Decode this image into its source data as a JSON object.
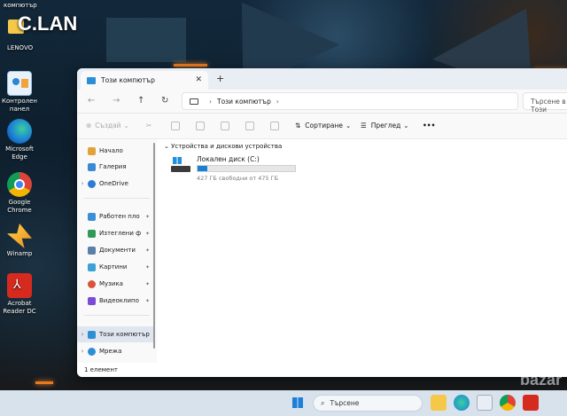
{
  "desktop": {
    "top_label": "компютър",
    "shortcut_lan": "C.LAN",
    "lenovo_label": "LENOVO",
    "icons": [
      {
        "label": "Контролен панел",
        "icon": "control-panel-icon"
      },
      {
        "label": "Microsoft Edge",
        "icon": "edge-icon"
      },
      {
        "label": "Google Chrome",
        "icon": "chrome-icon"
      },
      {
        "label": "Winamp",
        "icon": "winamp-icon"
      },
      {
        "label": "Acrobat Reader DC",
        "icon": "acrobat-icon"
      }
    ],
    "watermark": "bazar"
  },
  "explorer": {
    "tab_title": "Този компютър",
    "new_tab": "+",
    "close": "✕",
    "nav": {
      "back": "←",
      "forward": "→",
      "up": "↑",
      "refresh": "↻"
    },
    "address": {
      "path": "Този компютър",
      "sep": "›",
      "chevron": "›"
    },
    "search_placeholder": "Търсене в Този",
    "toolbar": {
      "new_label": "Създай",
      "sort_label": "Сортиране",
      "view_label": "Преглед",
      "more": "•••"
    },
    "sidebar": {
      "items": [
        {
          "label": "Начало",
          "icon": "home-icon",
          "color": "#e0a33a"
        },
        {
          "label": "Галерия",
          "icon": "gallery-icon",
          "color": "#3a8ad6"
        },
        {
          "label": "OneDrive",
          "icon": "cloud-icon",
          "color": "#2b7cd3"
        },
        {
          "label": "Работен пло",
          "icon": "desktop-icon",
          "color": "#3b8fd9"
        },
        {
          "label": "Изтеглени ф",
          "icon": "download-icon",
          "color": "#2f9a55"
        },
        {
          "label": "Документи",
          "icon": "documents-icon",
          "color": "#5a7fa8"
        },
        {
          "label": "Картини",
          "icon": "pictures-icon",
          "color": "#3aa1d9"
        },
        {
          "label": "Музика",
          "icon": "music-icon",
          "color": "#d9533a"
        },
        {
          "label": "Видеоклипо",
          "icon": "video-icon",
          "color": "#7a4ad9"
        },
        {
          "label": "Този компютър",
          "icon": "pc-icon",
          "color": "#2c8fd6"
        },
        {
          "label": "Мрежа",
          "icon": "network-icon",
          "color": "#2c8fd6"
        }
      ],
      "pin": "📌"
    },
    "group_header": "Устройства и дискови устройства",
    "drive": {
      "name": "Локален диск (C:)",
      "usage_fraction": 0.097,
      "free_text": "427 ГБ свободни от 475 ГБ"
    },
    "status": "1 елемент"
  },
  "taskbar": {
    "search_label": "Търсене"
  }
}
